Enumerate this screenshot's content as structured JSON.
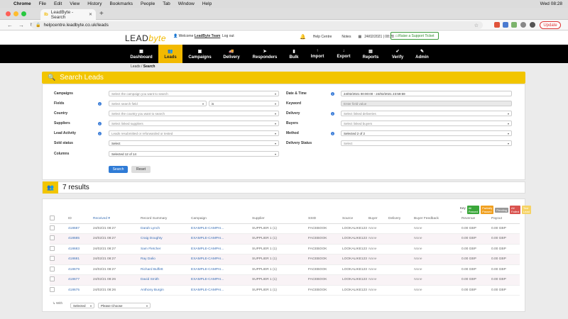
{
  "os": {
    "app": "Chrome",
    "menus": [
      "File",
      "Edit",
      "View",
      "History",
      "Bookmarks",
      "People",
      "Tab",
      "Window",
      "Help"
    ],
    "clock": "Wed 08:28"
  },
  "browser": {
    "tab_title": "LeadByte - Search",
    "url": "helpcentre.leadbyte.co.uk/leads",
    "update_label": "Update"
  },
  "header": {
    "logo_main": "LEAD",
    "logo_accent": "byte",
    "welcome_prefix": "Welcome",
    "welcome_user": "LeadByte Team",
    "logout": "Log out",
    "help": "Help Centre",
    "notes": "Notes",
    "date": "24/02/2021 | 08:28",
    "ticket": "Raise a Support Ticket"
  },
  "nav": [
    {
      "label": "Dashboard",
      "icon": "▦"
    },
    {
      "label": "Leads",
      "icon": "👥"
    },
    {
      "label": "Campaigns",
      "icon": "▣"
    },
    {
      "label": "Delivery",
      "icon": "🚚"
    },
    {
      "label": "Responders",
      "icon": "➤"
    },
    {
      "label": "Bulk",
      "icon": "▮"
    },
    {
      "label": "Import",
      "icon": "↑"
    },
    {
      "label": "Export",
      "icon": "↓"
    },
    {
      "label": "Reports",
      "icon": "▤"
    },
    {
      "label": "Verify",
      "icon": "✔"
    },
    {
      "label": "Admin",
      "icon": "✎"
    }
  ],
  "breadcrumb": {
    "parent": "Leads",
    "sep": " / ",
    "current": "Search"
  },
  "search": {
    "title": "Search Leads",
    "left": [
      {
        "label": "Campaigns",
        "value": "Select the campaign you want to search"
      },
      {
        "label": "Fields",
        "value": "Select search field",
        "op": "is"
      },
      {
        "label": "Country",
        "value": "Select the country you want to search"
      },
      {
        "label": "Suppliers",
        "value": "Select linked suppliers"
      },
      {
        "label": "Lead Activity",
        "value": "Leads resubmitted or reforwarded or tested"
      },
      {
        "label": "Sold status",
        "value": "Select"
      },
      {
        "label": "Columns",
        "value": "Selected 12 of 14"
      }
    ],
    "right": [
      {
        "label": "Date & Time",
        "value": "24/02/2021 00:00:00 - 24/02/2021 23:59:59"
      },
      {
        "label": "Keyword",
        "value": "Enter field value"
      },
      {
        "label": "Delivery",
        "value": "Select linked deliveries"
      },
      {
        "label": "Buyers",
        "value": "Select linked buyers"
      },
      {
        "label": "Method",
        "value": "Selected 2 of 2"
      },
      {
        "label": "Delivery Status",
        "value": "Select"
      }
    ],
    "search_btn": "Search",
    "reset_btn": "Reset"
  },
  "results": {
    "title": "7 results",
    "key_label": "Key =",
    "key": [
      {
        "label": "All Passed",
        "color": "#3aa73a"
      },
      {
        "label": "Partially Passed",
        "color": "#f0a020"
      },
      {
        "label": "Pending",
        "color": "#999999"
      },
      {
        "label": "All Failed",
        "color": "#d9534f"
      },
      {
        "label": "Test Lead",
        "color": "#f6d365"
      }
    ],
    "columns": [
      "",
      "ID",
      "Received ▾",
      "Record Summary",
      "Campaign",
      "Supplier",
      "SSID",
      "Source",
      "Buyer",
      "Delivery",
      "Buyer Feedback",
      "Revenue",
      "Payout"
    ],
    "rows": [
      [
        "418687",
        "24/02/21 08:27",
        "Darah Lynch",
        "EXAMPLE-CAMPAI...",
        "SUPPLIER 1 (1)",
        "FACEBOOK",
        "LOOKALIKE123",
        "None",
        "",
        "None",
        "0.00 GBP",
        "0.00 GBP"
      ],
      [
        "418685",
        "24/02/21 08:27",
        "Craig Doughty",
        "EXAMPLE-CAMPAI...",
        "SUPPLIER 1 (1)",
        "FACEBOOK",
        "LOOKALIKE123",
        "None",
        "",
        "None",
        "0.00 GBP",
        "0.00 GBP"
      ],
      [
        "418683",
        "24/02/21 08:27",
        "Sam Fletcher",
        "EXAMPLE-CAMPAI...",
        "SUPPLIER 1 (1)",
        "FACEBOOK",
        "LOOKALIKE123",
        "None",
        "",
        "None",
        "0.00 GBP",
        "0.00 GBP"
      ],
      [
        "418681",
        "24/02/21 08:27",
        "Ray Dalio",
        "EXAMPLE-CAMPAI...",
        "SUPPLIER 1 (1)",
        "FACEBOOK",
        "LOOKALIKE123",
        "None",
        "",
        "None",
        "0.00 GBP",
        "0.00 GBP"
      ],
      [
        "418679",
        "24/02/21 08:27",
        "Richard Buffett",
        "EXAMPLE-CAMPAI...",
        "SUPPLIER 1 (1)",
        "FACEBOOK",
        "LOOKALIKE123",
        "None",
        "",
        "None",
        "0.00 GBP",
        "0.00 GBP"
      ],
      [
        "418677",
        "24/02/21 08:26",
        "David Smith",
        "EXAMPLE-CAMPAI...",
        "SUPPLIER 1 (1)",
        "FACEBOOK",
        "LOOKALIKE123",
        "None",
        "",
        "None",
        "0.00 GBP",
        "0.00 GBP"
      ],
      [
        "418675",
        "24/02/21 08:26",
        "Anthony Burgin",
        "EXAMPLE-CAMPAI...",
        "SUPPLIER 1 (1)",
        "FACEBOOK",
        "LOOKALIKE123",
        "None",
        "",
        "None",
        "0.00 GBP",
        "0.00 GBP"
      ]
    ],
    "with_label": "With",
    "bulk_select": "Selected",
    "bulk_action": "Please Choose"
  }
}
